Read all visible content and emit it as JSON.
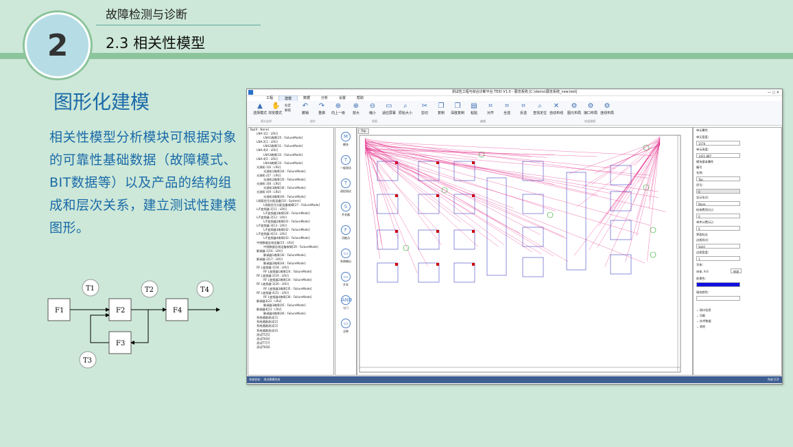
{
  "slide": {
    "number": "2",
    "section_top": "故障检测与诊断",
    "section_title": "2.3 相关性模型",
    "heading": "图形化建模",
    "paragraph": "相关性模型分析模块可根据对象的可靠性基础数据（故障模式、BIT数据等）以及产品的结构组成和层次关系，建立测试性建模图形。",
    "diagram": {
      "nodes": [
        "F1",
        "F2",
        "F4",
        "F3"
      ],
      "tests": [
        "T1",
        "T2",
        "T4",
        "T3"
      ]
    }
  },
  "app": {
    "title": "测试性工程与综合诊断平台 TEID V1.0 - 展览系统 [C:\\demo\\展览系统_new.teid]",
    "menus": [
      "工程",
      "建模",
      "数据",
      "分析",
      "设置",
      "帮助"
    ],
    "active_menu": "建模",
    "ribbon": [
      {
        "label": "选择模式",
        "icon": "▲"
      },
      {
        "label": "浏览模式",
        "icon": "✋"
      },
      {
        "label": "撤销",
        "icon": "↶"
      },
      {
        "label": "重做",
        "icon": "↷"
      },
      {
        "label": "向上一级",
        "icon": "⊕"
      },
      {
        "label": "放大",
        "icon": "⊕"
      },
      {
        "label": "缩小",
        "icon": "⊖"
      },
      {
        "label": "适应屏幕",
        "icon": "▭"
      },
      {
        "label": "原始大小",
        "icon": "⌕"
      },
      {
        "label": "剪切",
        "icon": "✂"
      },
      {
        "label": "复制",
        "icon": "❐"
      },
      {
        "label": "深度复制",
        "icon": "❐"
      },
      {
        "label": "粘贴",
        "icon": "▤"
      },
      {
        "label": "对齐",
        "icon": "⌗"
      },
      {
        "label": "全选",
        "icon": "⌗"
      },
      {
        "label": "反选",
        "icon": "⌗"
      },
      {
        "label": "查找定位",
        "icon": "⌕"
      },
      {
        "label": "自动布线",
        "icon": "✕"
      },
      {
        "label": "图元布局",
        "icon": "⚙"
      },
      {
        "label": "接口布局",
        "icon": "⚙"
      },
      {
        "label": "连线布局",
        "icon": "⚙"
      }
    ],
    "ribbon_small": [
      "标定",
      "解锁"
    ],
    "ribbon_groups": [
      "模式选择",
      "操作",
      "视图",
      "编辑",
      "快速建模"
    ],
    "tree": [
      "Top[0 : None]",
      "LNA-1[2 : LRU]",
      "LNA1故障[25 : FailureMode]",
      "LNA-2[1 : LRU]",
      "LNA2故障[31 : FailureMode]",
      "LNA-4[4 : LRU]",
      "LNA3故障[32 : FailureMode]",
      "LNA-4[5 : LRU]",
      "LNA4故障[33 : FailureMode]",
      "光源机-1[6 : LRU]",
      "光源机1故障[34 : FailureMode]",
      "光源机-2[7 : LRU]",
      "光源机2故障[35 : FailureMode]",
      "光源机-3[8 : LRU]",
      "光源机3故障[36 : FailureMode]",
      "光源机-4[9 : LRU]",
      "光源机4故障[40 : FailureMode]",
      "L频段信号分配设备[10 : System]",
      "L频段信号分配设备故障[27 : FailureMode]",
      "L/F变频器-1[11 : LRU]",
      "L/F变频器1故障[28 : FailureMode]",
      "L/F变频器-2[12 : LRU]",
      "L/F变频器2故障[41 : FailureMode]",
      "L/F变频器-3[13 : LRU]",
      "L/F变频器3故障[42 : FailureMode]",
      "L/F变频器-4[14 : LRU]",
      "L/F变频器4故障[43 : FailureMode]",
      "中频数据总线设备[15 : LRU]",
      "中频数据总线设备故障[29 : FailureMode]",
      "解调器-1[16 : LRU]",
      "解调器1故障[30 : FailureMode]",
      "解调器-2[17 : LRU]",
      "解调器2故障[44 : FailureMode]",
      "RF L变频器-1[18 : LRU]",
      "RF L变频器1故障[24 : FailureMode]",
      "RF L变频器-2[19 : LRU]",
      "RF L变频器2故障[34 : FailureMode]",
      "RF L变频器-3[20 : LRU]",
      "RF L变频器3故障[35 : FailureMode]",
      "RF L变频器-4[21 : LRU]",
      "RF L变频器4故障[36 : FailureMode]",
      "解调器3[22 : LRU]",
      "解调器3故障[45 : FailureMode]",
      "解调器4[23 : LRU]",
      "解调器4故障[46 : FailureMode]",
      "系统通路测试[1]",
      "系统通路测试[2]",
      "系统通路测试[3]",
      "系统通路测试[4]",
      "测试T5[5]",
      "测试T6[6]",
      "测试T7[7]",
      "测试T8[8]"
    ],
    "palette": [
      "模块",
      "一般测试",
      "测控测试",
      "开关器",
      "功能点",
      "系统输出",
      "开关",
      "与门",
      "注释"
    ],
    "palette_icons": [
      "M",
      "T",
      "T",
      "S",
      "F",
      "▭",
      "▭",
      "AND",
      "▭"
    ],
    "canvas_tab": "Top",
    "props": {
      "title": "单元属性",
      "width_label": "单元宽度：",
      "width_val": "1570",
      "height_label": "单元高度：",
      "height_val": "1421.887",
      "basic_label": "模块基本属性",
      "id_label": "编号",
      "name_label": "名称：",
      "name_val": "Top",
      "no_label": "序号：",
      "no_val": "0",
      "disp_label": "显示形式：",
      "disp_val": "None",
      "delay1_label": "检修费用(元)：",
      "delay1_val": "0",
      "delay2_label": "单件计费(元)：",
      "delay2_val": "0",
      "border_label": "界面标志",
      "line_label": "边框样式：",
      "line_val": "Solid",
      "lw_label": "边框宽度：",
      "lw_val": "1",
      "font_label": "字体：",
      "font_val": "宋体, 9.0",
      "font_btn": "修改",
      "fore_label": "前景色：",
      "back_label": "填充颜色：",
      "sections": [
        "接口信息",
        "功能",
        "技术数据",
        "其他"
      ]
    },
    "status": "系统状态：  测试建模完成",
    "status_right": "完成 打开",
    "colors": {
      "accent": "#1a6aa8",
      "status": "#3d5e91",
      "wire": "#e0107a",
      "block": "#1a1ab8",
      "test": "#18a018"
    }
  }
}
